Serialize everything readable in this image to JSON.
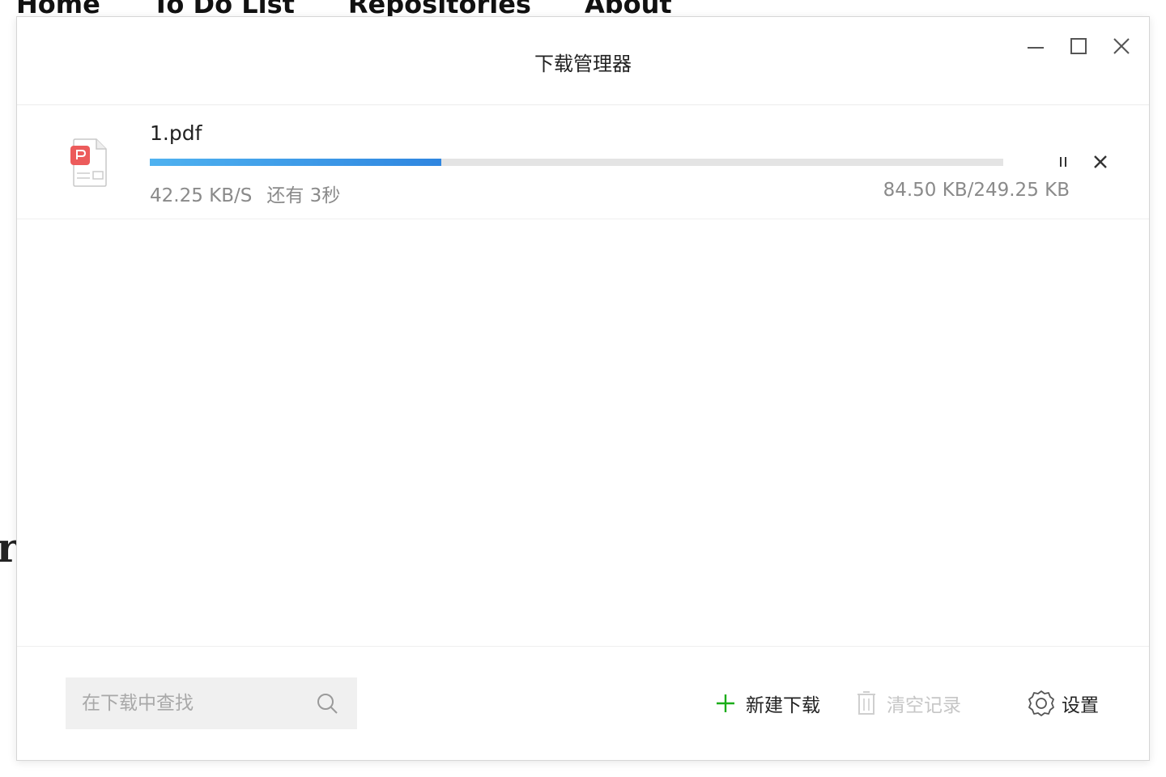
{
  "background_page": {
    "nav": [
      "Home",
      "To Do List",
      "Repositories",
      "About"
    ],
    "partial_heading_char": "r"
  },
  "window": {
    "title": "下载管理器",
    "controls": {
      "minimize_icon": "minimize-icon",
      "maximize_icon": "maximize-icon",
      "close_icon": "close-icon"
    }
  },
  "downloads": [
    {
      "file_name": "1.pdf",
      "file_type_icon": "pdf-file-icon",
      "speed": "42.25 KB/S",
      "time_remaining": "还有 3秒",
      "size_progress": "84.50 KB/249.25 KB",
      "progress_fraction": 0.342,
      "progress_color": "#2f86e0",
      "actions": {
        "pause_icon": "pause-icon",
        "cancel_icon": "cancel-icon"
      }
    }
  ],
  "footer": {
    "search_placeholder": "在下载中查找",
    "new_download_label": "新建下载",
    "clear_history_label": "清空记录",
    "settings_label": "设置",
    "accent_green": "#1aad19"
  }
}
